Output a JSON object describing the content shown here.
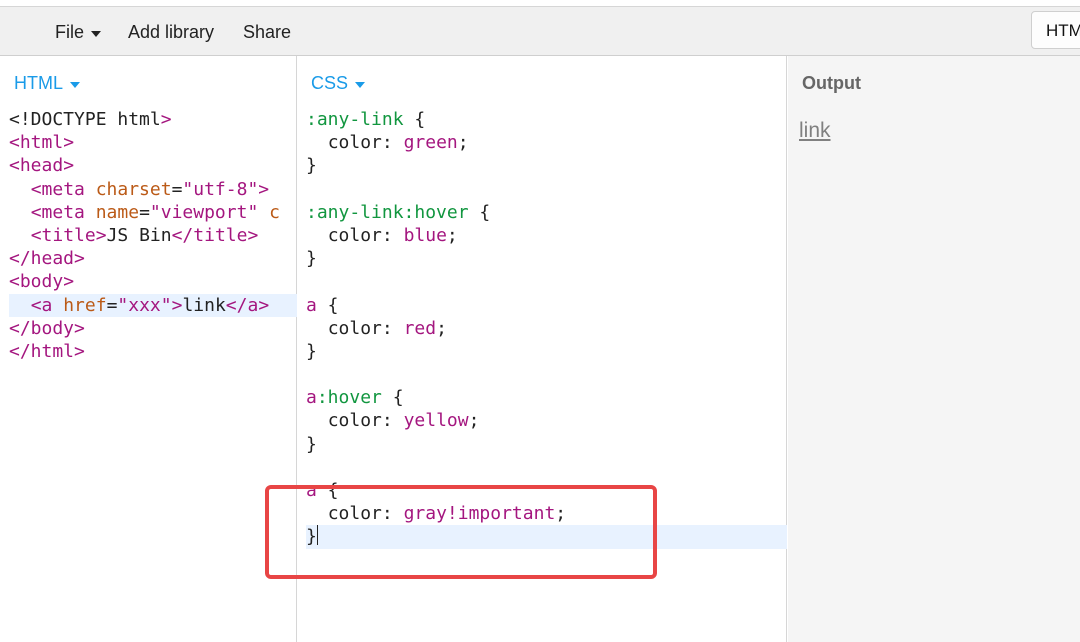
{
  "toolbar": {
    "file_label": "File",
    "add_library_label": "Add library",
    "share_label": "Share",
    "html_tab_label": "HTML"
  },
  "html_panel": {
    "label": "HTML",
    "lines": [
      "<!DOCTYPE html>",
      "<html>",
      "<head>",
      "  <meta charset=\"utf-8\">",
      "  <meta name=\"viewport\" c",
      "  <title>JS Bin</title>",
      "</head>",
      "<body>",
      "  <a href=\"xxx\">link</a>",
      "</body>",
      "</html>"
    ],
    "highlighted_line": 8
  },
  "css_panel": {
    "label": "CSS",
    "lines": [
      ":any-link {",
      "  color: green;",
      "}",
      "",
      ":any-link:hover {",
      "  color: blue;",
      "}",
      "",
      "a {",
      "  color: red;",
      "}",
      "",
      "a:hover {",
      "  color: yellow;",
      "}",
      "",
      "a {",
      "  color: gray!important;",
      "}"
    ],
    "highlighted_line": 18
  },
  "output_panel": {
    "label": "Output",
    "link_text": "link"
  },
  "colors": {
    "accent": "#1a9be8",
    "tag": "#a4167f",
    "attr": "#bb5a17",
    "pseudo": "#11963f",
    "annotation": "#e84545",
    "line_highlight": "#e8f2ff"
  }
}
